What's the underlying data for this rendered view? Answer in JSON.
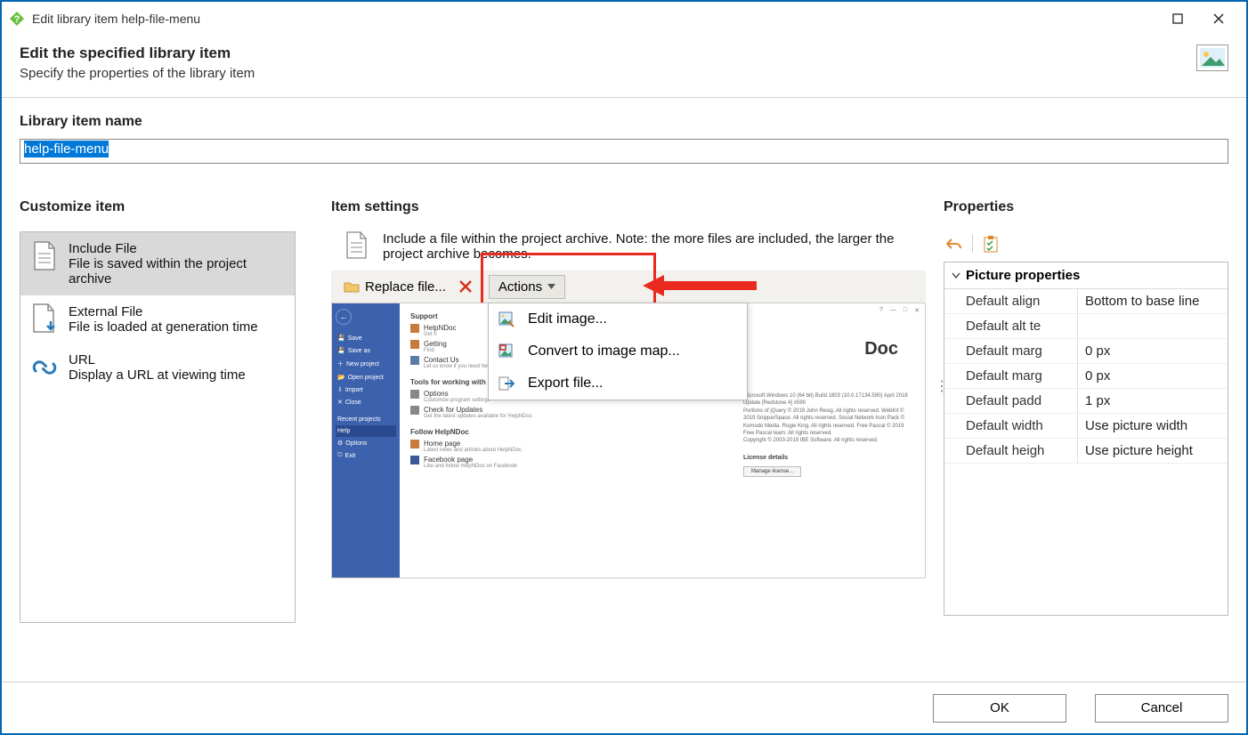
{
  "window": {
    "title": "Edit library item help-file-menu"
  },
  "header": {
    "title": "Edit the specified library item",
    "subtitle": "Specify the properties of the library item"
  },
  "name_field": {
    "label": "Library item name",
    "value": "help-file-menu"
  },
  "customize": {
    "title": "Customize item",
    "items": [
      {
        "title": "Include File",
        "desc": "File is saved within the project archive",
        "icon": "file-icon",
        "selected": true
      },
      {
        "title": "External File",
        "desc": "File is loaded at generation time",
        "icon": "file-download-icon",
        "selected": false
      },
      {
        "title": "URL",
        "desc": "Display a URL at viewing time",
        "icon": "link-icon",
        "selected": false
      }
    ]
  },
  "settings": {
    "title": "Item settings",
    "description": "Include a file within the project archive. Note: the more files are included, the larger the project archive becomes.",
    "replace_label": "Replace file...",
    "actions_label": "Actions",
    "menu": [
      {
        "label": "Edit image...",
        "icon": "edit-image-icon"
      },
      {
        "label": "Convert to image map...",
        "icon": "image-map-icon"
      },
      {
        "label": "Export file...",
        "icon": "export-icon"
      }
    ]
  },
  "preview": {
    "brand": "Doc",
    "sidebar": [
      "Save",
      "Save as",
      "New project",
      "Open project",
      "Import",
      "Close",
      "Recent projects",
      "Help",
      "Options",
      "Exit"
    ],
    "sidebar_selected": "Help",
    "sections": {
      "support": {
        "title": "Support",
        "rows": [
          {
            "t": "HelpNDoc",
            "d": "Get h"
          },
          {
            "t": "Getting",
            "d": "Find"
          },
          {
            "t": "Contact Us",
            "d": "Let us know if you need help or how we can make HelpNDoc better"
          }
        ]
      },
      "tools": {
        "title": "Tools for working with HelpNDoc",
        "rows": [
          {
            "t": "Options",
            "d": "Customize program settings"
          },
          {
            "t": "Check for Updates",
            "d": "Get the latest updates available for HelpNDoc"
          }
        ]
      },
      "follow": {
        "title": "Follow HelpNDoc",
        "rows": [
          {
            "t": "Home page",
            "d": "Latest news and articles about HelpNDoc"
          },
          {
            "t": "Facebook page",
            "d": "Like and follow HelpNDoc on Facebook"
          }
        ]
      }
    },
    "license": {
      "lines": [
        "Microsoft Windows 10 (64 bit) Build 1803 (10.0.17134.590) April 2018 Update [Redstone 4] #590",
        "Portions of jQuery © 2019 John Resig. All rights reserved. WebKit © 2019 SnipperSpace. All rights reserved. Social Network Icon Pack © Komodo Media. Rogie King. All rights reserved. Free Pascal © 2019 Free Pascal team. All rights reserved.",
        "Copyright © 2003-2019 IBE Software. All rights reserved."
      ],
      "title": "License details",
      "button": "Manage license..."
    }
  },
  "properties": {
    "title": "Properties",
    "group": "Picture properties",
    "rows": [
      {
        "key": "Default align",
        "val": "Bottom to base line"
      },
      {
        "key": "Default alt te",
        "val": ""
      },
      {
        "key": "Default marg",
        "val": "0 px"
      },
      {
        "key": "Default marg",
        "val": "0 px"
      },
      {
        "key": "Default padd",
        "val": "1 px"
      },
      {
        "key": "Default width",
        "val": "Use picture width"
      },
      {
        "key": "Default heigh",
        "val": "Use picture height"
      }
    ]
  },
  "footer": {
    "ok": "OK",
    "cancel": "Cancel"
  }
}
